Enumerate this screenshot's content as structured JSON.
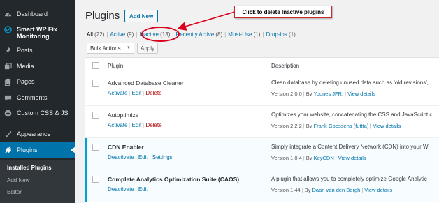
{
  "sidebar": {
    "items": [
      {
        "label": "Dashboard",
        "icon": "dashboard-icon"
      },
      {
        "label": "Smart WP Fix Monitoring",
        "icon": "wp-fix-icon"
      },
      {
        "label": "Posts",
        "icon": "pin-icon"
      },
      {
        "label": "Media",
        "icon": "media-icon"
      },
      {
        "label": "Pages",
        "icon": "pages-icon"
      },
      {
        "label": "Comments",
        "icon": "comments-icon"
      },
      {
        "label": "Custom CSS & JS",
        "icon": "plus-circle-icon"
      },
      {
        "label": "Appearance",
        "icon": "paintbrush-icon"
      },
      {
        "label": "Plugins",
        "icon": "plugin-icon"
      }
    ],
    "submenu": [
      "Installed Plugins",
      "Add New",
      "Editor"
    ]
  },
  "header": {
    "title": "Plugins",
    "add_new": "Add New"
  },
  "filters": {
    "all": {
      "label": "All",
      "count": "(22)"
    },
    "active": {
      "label": "Active",
      "count": "(9)"
    },
    "inactive": {
      "label": "Inactive",
      "count": "(13)"
    },
    "recently_active": {
      "label": "Recently Active",
      "count": "(8)"
    },
    "must_use": {
      "label": "Must-Use",
      "count": "(1)"
    },
    "dropins": {
      "label": "Drop-ins",
      "count": "(1)"
    },
    "separator": "|"
  },
  "bulk": {
    "select": "Bulk Actions",
    "apply": "Apply"
  },
  "annotation": "Click to delete Inactive plugins",
  "table": {
    "col_plugin": "Plugin",
    "col_description": "Description",
    "rows": [
      {
        "name": "Advanced Database Cleaner",
        "a1": "Activate",
        "a2": "Edit",
        "a3": "Delete",
        "desc": "Clean database by deleting unused data such as 'old revisions',",
        "version": "Version 2.0.0",
        "by": "By",
        "author": "Younes JFR.",
        "details": "View details"
      },
      {
        "name": "Autoptimize",
        "a1": "Activate",
        "a2": "Edit",
        "a3": "Delete",
        "desc": "Optimizes your website, concatenating the CSS and JavaScript c",
        "version": "Version 2.2.2",
        "by": "By",
        "author": "Frank Goossens (futtta)",
        "details": "View details"
      },
      {
        "name": "CDN Enabler",
        "a1": "Deactivate",
        "a2": "Edit",
        "a3": "Settings",
        "desc": "Simply integrate a Content Delivery Network (CDN) into your W",
        "version": "Version 1.0.4",
        "by": "By",
        "author": "KeyCDN",
        "details": "View details"
      },
      {
        "name": "Complete Analytics Optimization Suite (CAOS)",
        "a1": "Deactivate",
        "a2": "Edit",
        "desc": "A plugin that allows you to completely optimize Google Analytic",
        "version": "Version 1.44",
        "by": "By",
        "author": "Daan van den Bergh",
        "details": "View details"
      }
    ]
  },
  "colors": {
    "sidebar_bg": "#23282d",
    "accent": "#0073aa",
    "delete": "#aa0000",
    "annotation_red": "#d9001b"
  }
}
